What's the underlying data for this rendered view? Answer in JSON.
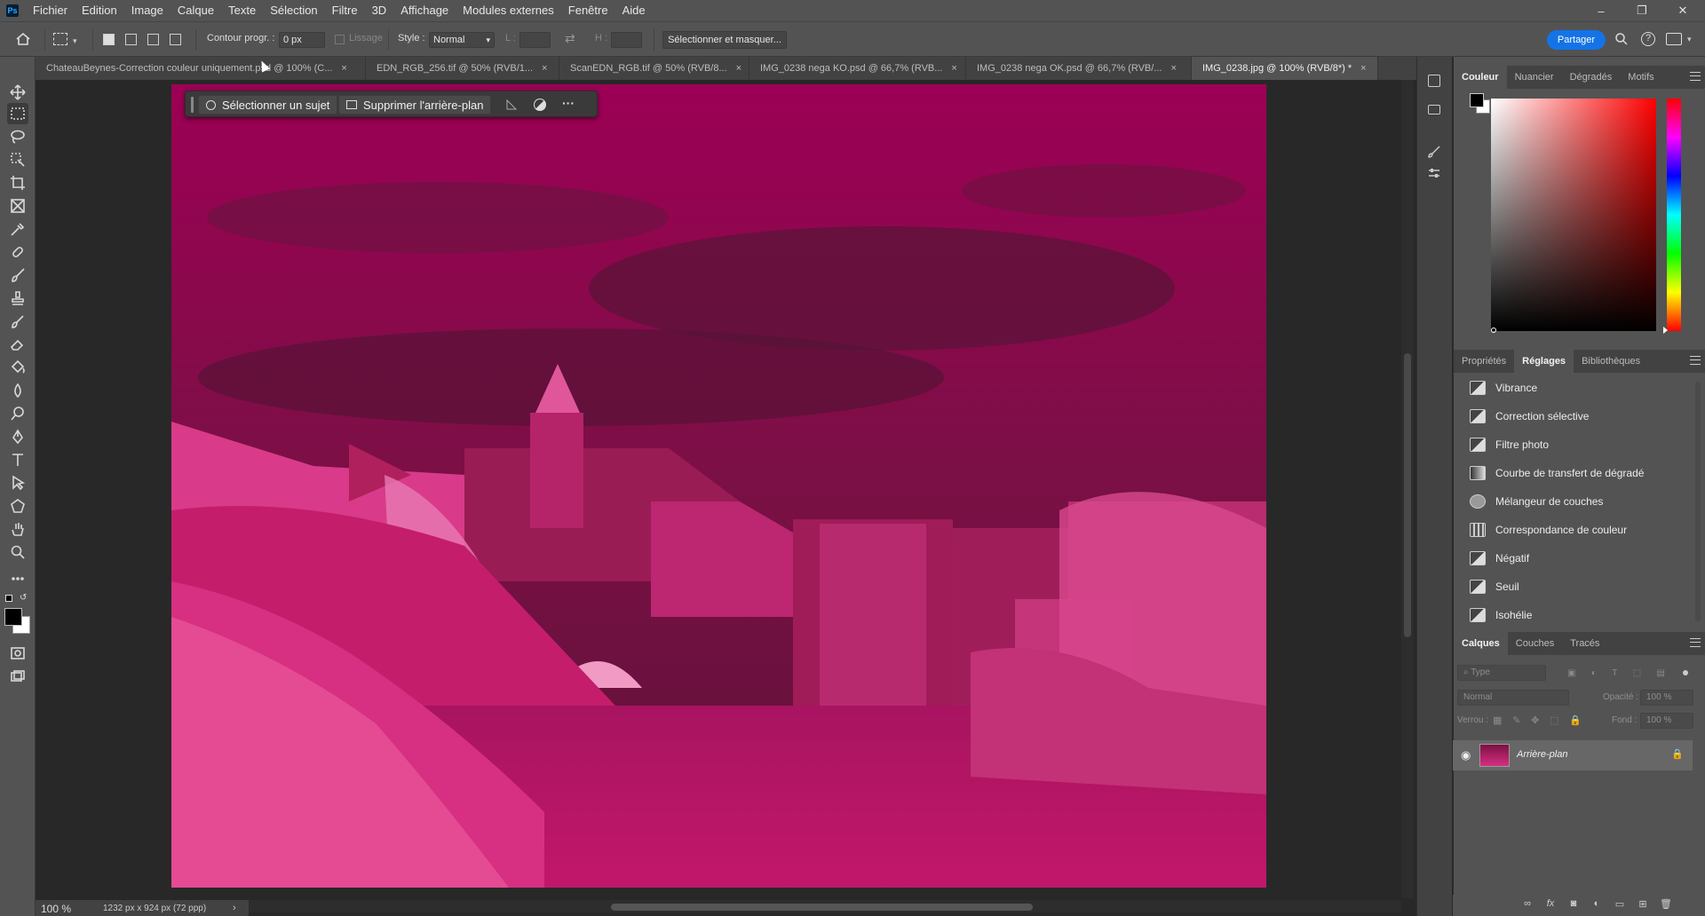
{
  "app": {
    "logo": "Ps"
  },
  "menu": [
    "Fichier",
    "Edition",
    "Image",
    "Calque",
    "Texte",
    "Sélection",
    "Filtre",
    "3D",
    "Affichage",
    "Modules externes",
    "Fenêtre",
    "Aide"
  ],
  "window_controls": {
    "minimize": "–",
    "maximize": "❐",
    "close": "✕"
  },
  "options": {
    "feather_label": "Contour progr. :",
    "feather_value": "0 px",
    "antialias_label": "Lissage",
    "style_label": "Style :",
    "style_value": "Normal",
    "width_label": "L :",
    "height_label": "H :",
    "select_mask_label": "Sélectionner et masquer...",
    "share_label": "Partager"
  },
  "tabs": [
    {
      "label": "ChateauBeynes-Correction couleur uniquement.psd @ 100% (C..."
    },
    {
      "label": "EDN_RGB_256.tif @ 50% (RVB/1..."
    },
    {
      "label": "ScanEDN_RGB.tif @ 50% (RVB/8..."
    },
    {
      "label": "IMG_0238 nega KO.psd @ 66,7% (RVB..."
    },
    {
      "label": "IMG_0238 nega OK.psd @ 66,7% (RVB/..."
    },
    {
      "label": "IMG_0238.jpg @ 100% (RVB/8*) *"
    }
  ],
  "tab_close": "×",
  "context_bar": {
    "select_subject": "Sélectionner un sujet",
    "remove_bg": "Supprimer l'arrière-plan",
    "more": "···"
  },
  "status": {
    "zoom": "100 %",
    "doc_info": "1232 px x 924 px (72 ppp)"
  },
  "color_panel": {
    "tabs": [
      "Couleur",
      "Nuancier",
      "Dégradés",
      "Motifs"
    ]
  },
  "adjust_panel": {
    "tabs": [
      "Propriétés",
      "Réglages",
      "Bibliothèques"
    ],
    "items": [
      "Vibrance",
      "Correction sélective",
      "Filtre photo",
      "Courbe de transfert de dégradé",
      "Mélangeur de couches",
      "Correspondance de couleur",
      "Négatif",
      "Seuil",
      "Isohélie"
    ]
  },
  "layers_panel": {
    "tabs": [
      "Calques",
      "Couches",
      "Tracés"
    ],
    "filter_placeholder": "Type",
    "blend_mode": "Normal",
    "opacity_label": "Opacité :",
    "opacity_value": "100 %",
    "lock_label": "Verrou :",
    "fill_label": "Fond :",
    "fill_value": "100 %",
    "layer_name": "Arrière-plan"
  },
  "colors": {
    "accent": "#1473e6",
    "image_tint": "#d0146e"
  }
}
